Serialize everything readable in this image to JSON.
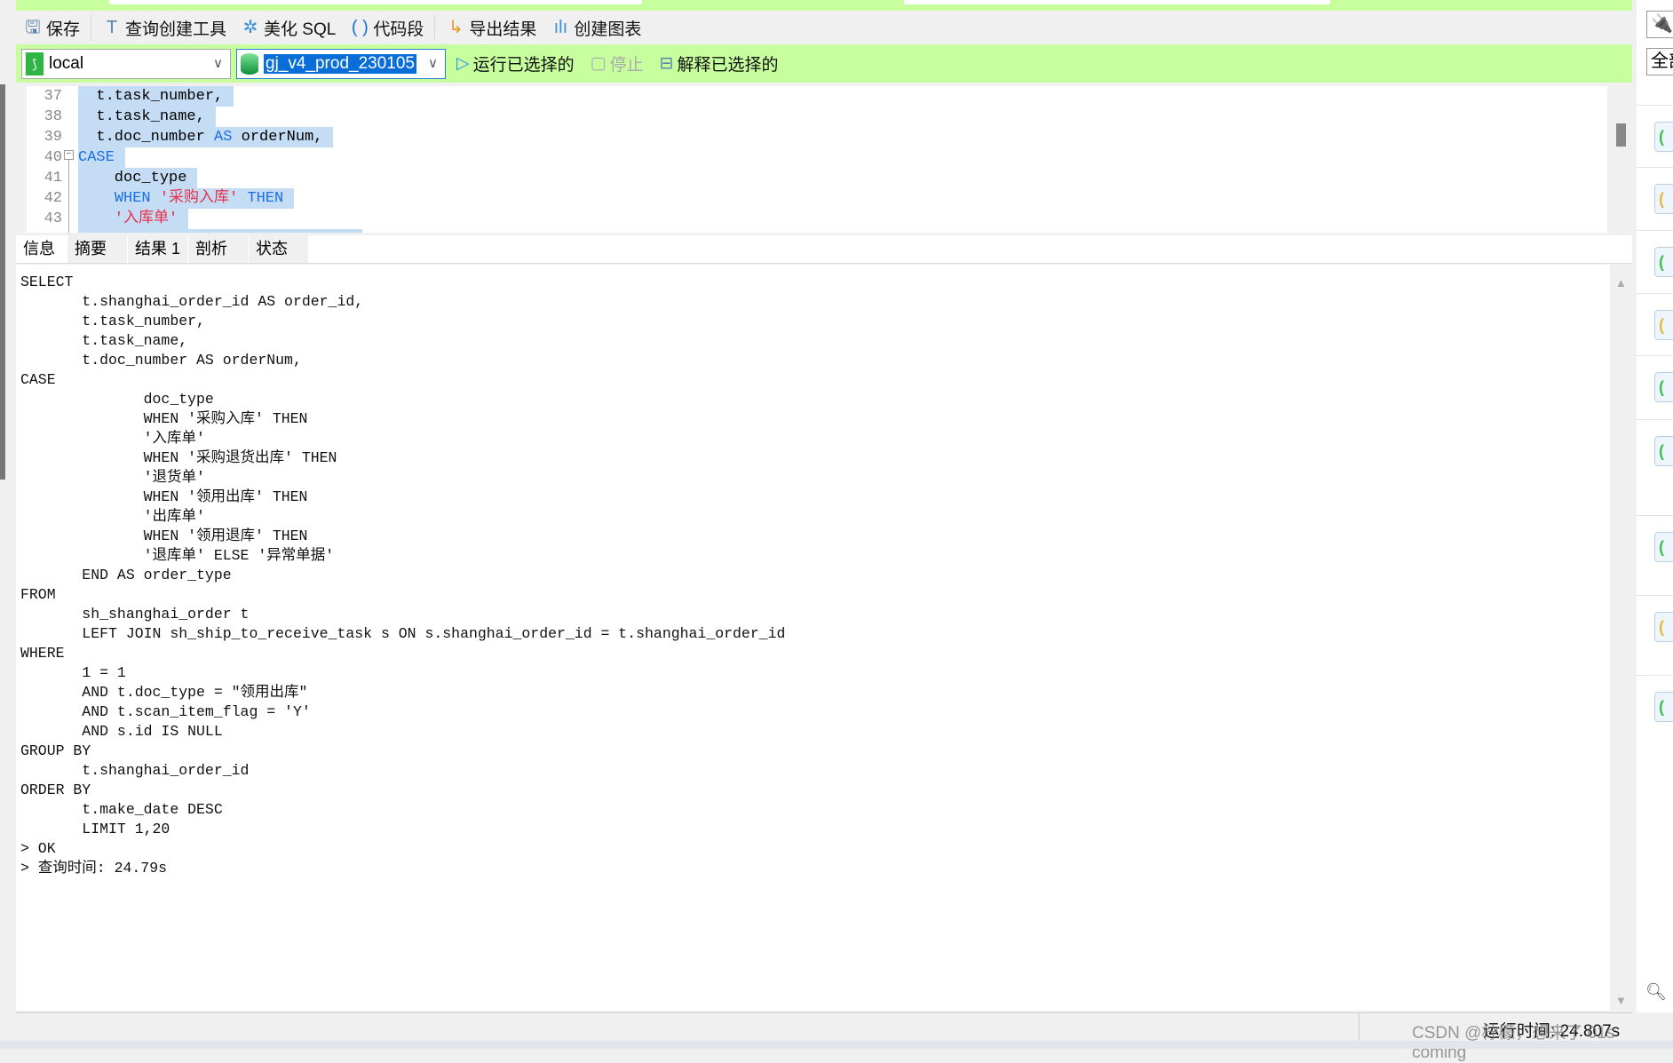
{
  "toolbar": {
    "save": "保存",
    "query_builder": "查询创建工具",
    "beautify": "美化 SQL",
    "snippet": "代码段",
    "export": "导出结果",
    "create_chart": "创建图表"
  },
  "connection": {
    "name": "local",
    "database": "gj_v4_prod_230105",
    "run_selected": "运行已选择的",
    "stop": "停止",
    "explain_selected": "解释已选择的"
  },
  "editor": {
    "lines": [
      {
        "num": "37",
        "parts": [
          {
            "t": "  t.task_number,",
            "c": ""
          }
        ]
      },
      {
        "num": "38",
        "parts": [
          {
            "t": "  t.task_name,",
            "c": ""
          }
        ]
      },
      {
        "num": "39",
        "parts": [
          {
            "t": "  t.doc_number ",
            "c": ""
          },
          {
            "t": "AS",
            "c": "kw"
          },
          {
            "t": " orderNum,",
            "c": ""
          }
        ]
      },
      {
        "num": "40",
        "parts": [
          {
            "t": "CASE",
            "c": "kw"
          }
        ]
      },
      {
        "num": "41",
        "parts": [
          {
            "t": "    doc_type",
            "c": ""
          }
        ]
      },
      {
        "num": "42",
        "parts": [
          {
            "t": "    ",
            "c": ""
          },
          {
            "t": "WHEN",
            "c": "kw"
          },
          {
            "t": " '采购入库' ",
            "c": "str"
          },
          {
            "t": "THEN",
            "c": "kw"
          }
        ]
      },
      {
        "num": "43",
        "parts": [
          {
            "t": "    '入库单'",
            "c": "str"
          }
        ]
      }
    ]
  },
  "tabs": [
    "信息",
    "摘要",
    "结果 1",
    "剖析",
    "状态"
  ],
  "results": {
    "lines": [
      "SELECT",
      "       t.shanghai_order_id AS order_id,",
      "       t.task_number,",
      "       t.task_name,",
      "       t.doc_number AS orderNum,",
      "CASE",
      "              doc_type",
      "              WHEN '采购入库' THEN",
      "              '入库单'",
      "              WHEN '采购退货出库' THEN",
      "              '退货单'",
      "              WHEN '领用出库' THEN",
      "              '出库单'",
      "              WHEN '领用退库' THEN",
      "              '退库单' ELSE '异常单据'",
      "       END AS order_type",
      "FROM",
      "       sh_shanghai_order t",
      "       LEFT JOIN sh_ship_to_receive_task s ON s.shanghai_order_id = t.shanghai_order_id",
      "WHERE",
      "       1 = 1",
      "       AND t.doc_type = \"领用出库\"",
      "       AND t.scan_item_flag = 'Y'",
      "       AND s.id IS NULL",
      "GROUP BY",
      "       t.shanghai_order_id",
      "ORDER BY",
      "       t.make_date DESC",
      "       LIMIT 1,20",
      "> OK",
      "> 查询时间: 24.79s"
    ]
  },
  "status": {
    "runtime": "运行时间: 24.807s"
  },
  "watermark": "CSDN @柠檬，想来了 01s coming",
  "right_panel": {
    "all_label": "全部",
    "search_hint": "搜",
    "items": [
      "green",
      "yellow",
      "green",
      "yellow",
      "green",
      "green",
      "green",
      "yellow",
      "green"
    ]
  },
  "colors": {
    "accent_green": "#c8ff9e",
    "selection": "#c5dcf5",
    "keyword": "#1a6fe0",
    "string": "#e8304a"
  }
}
